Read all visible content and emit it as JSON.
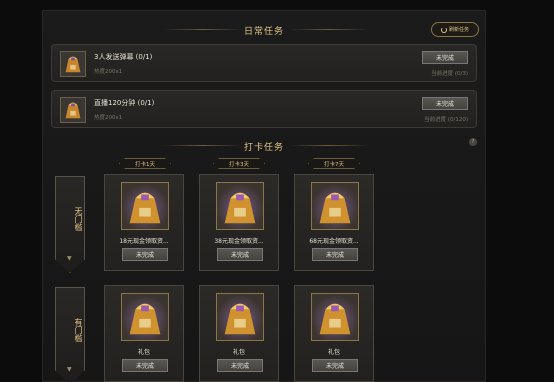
{
  "daily": {
    "title": "日常任务",
    "refresh_label": "刷新任务",
    "tasks": [
      {
        "name": "3人发送弹幕 (0/1)",
        "heat": "热度200x1",
        "button": "未完成",
        "progress": "当前进度 (0/3)"
      },
      {
        "name": "直播120分钟 (0/1)",
        "heat": "热度200x1",
        "button": "未完成",
        "progress": "当前进度 (0/120)"
      }
    ]
  },
  "checkin": {
    "title": "打卡任务",
    "help": "?",
    "days": [
      "打卡1天",
      "打卡3天",
      "打卡7天"
    ],
    "rows": [
      {
        "banner": "无门槛",
        "rewards": [
          {
            "name": "18元现金领取资...",
            "button": "未完成"
          },
          {
            "name": "38元现金领取资...",
            "button": "未完成"
          },
          {
            "name": "68元现金领取资...",
            "button": "未完成"
          }
        ]
      },
      {
        "banner": "有门槛",
        "rewards": [
          {
            "name": "礼包",
            "button": "未完成"
          },
          {
            "name": "礼包",
            "button": "未完成"
          },
          {
            "name": "礼包",
            "button": "未完成"
          }
        ]
      }
    ]
  },
  "icons": {
    "refresh": "refresh-icon",
    "reward": "gift-bag-icon",
    "help": "help-icon"
  },
  "colors": {
    "accent": "#e3c586",
    "background": "#161616",
    "button": "#4f4c48"
  }
}
